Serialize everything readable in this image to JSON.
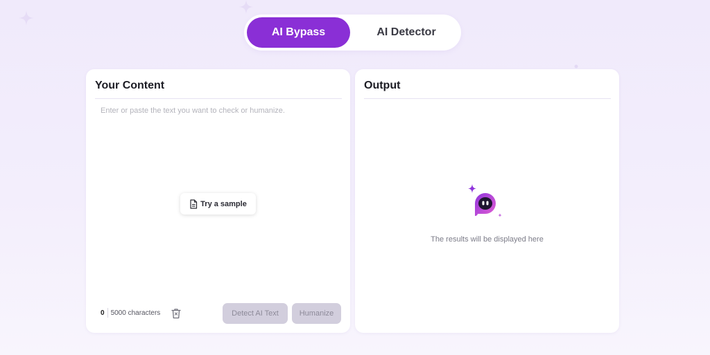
{
  "tabs": {
    "bypass_label": "AI Bypass",
    "detector_label": "AI Detector",
    "active": "AI Bypass"
  },
  "content_panel": {
    "title": "Your Content",
    "placeholder": "Enter or paste the text you want to check or humanize.",
    "value": "",
    "sample_button": "Try a sample",
    "char_count": "0",
    "char_limit": "5000 characters",
    "detect_button": "Detect AI Text",
    "humanize_button": "Humanize"
  },
  "output_panel": {
    "title": "Output",
    "empty_message": "The results will be displayed here"
  },
  "colors": {
    "accent": "#8a2fd6",
    "disabled_button": "#d2cedd",
    "background": "#f0eafb"
  },
  "icons": {
    "sample": "document-icon",
    "clear": "trash-icon",
    "mascot": "robot-mascot-icon",
    "decoration": "sparkle-icon"
  }
}
